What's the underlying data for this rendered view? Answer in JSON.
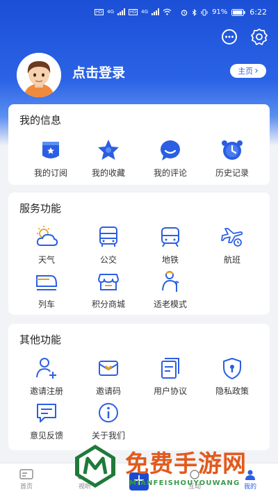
{
  "status": {
    "left": [
      "HD",
      "4G",
      "HD",
      "4G"
    ],
    "battery_pct": "91%",
    "time": "6:22"
  },
  "header": {
    "login_text": "点击登录",
    "home_button": "主页",
    "home_chevron": "›"
  },
  "my_info": {
    "title": "我的信息",
    "items": [
      {
        "label": "我的订阅",
        "icon": "subscription-icon"
      },
      {
        "label": "我的收藏",
        "icon": "star-icon"
      },
      {
        "label": "我的评论",
        "icon": "comment-icon"
      },
      {
        "label": "历史记录",
        "icon": "clock-icon"
      }
    ]
  },
  "services": {
    "title": "服务功能",
    "items": [
      {
        "label": "天气",
        "icon": "weather-icon"
      },
      {
        "label": "公交",
        "icon": "bus-icon"
      },
      {
        "label": "地铁",
        "icon": "subway-icon"
      },
      {
        "label": "航班",
        "icon": "plane-icon"
      },
      {
        "label": "列车",
        "icon": "train-icon"
      },
      {
        "label": "积分商城",
        "icon": "store-icon"
      },
      {
        "label": "适老模式",
        "icon": "elderly-icon"
      }
    ]
  },
  "other": {
    "title": "其他功能",
    "items": [
      {
        "label": "邀请注册",
        "icon": "add-user-icon"
      },
      {
        "label": "邀请码",
        "icon": "envelope-icon"
      },
      {
        "label": "用户协议",
        "icon": "document-icon"
      },
      {
        "label": "隐私政策",
        "icon": "shield-icon"
      },
      {
        "label": "意见反馈",
        "icon": "feedback-icon"
      },
      {
        "label": "关于我们",
        "icon": "info-icon"
      }
    ]
  },
  "tabs": [
    {
      "label": "首页"
    },
    {
      "label": "视听"
    },
    {
      "label": "互动"
    },
    {
      "label": "我的"
    }
  ],
  "plus": "+",
  "watermark": {
    "title": "免费手游网",
    "subtitle": "MIANFEISHOUYOUWANG"
  },
  "colors": {
    "brand": "#2b5ee3",
    "accent": "#1d4bd0"
  }
}
